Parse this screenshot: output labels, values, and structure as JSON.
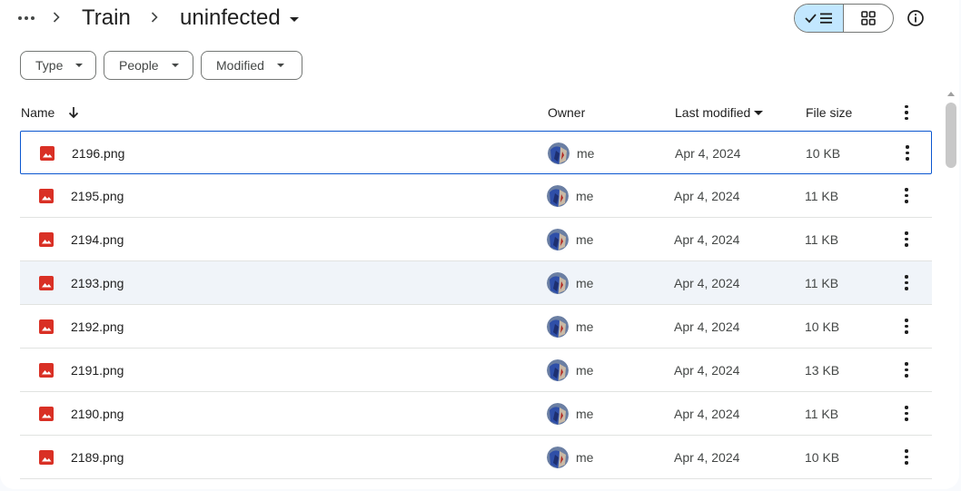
{
  "breadcrumb": {
    "parent": "Train",
    "current": "uninfected"
  },
  "toolbar": {
    "list_view_icon": "check-list-icon",
    "grid_view_icon": "grid-icon",
    "info_icon": "info-icon"
  },
  "filters": [
    {
      "label": "Type"
    },
    {
      "label": "People"
    },
    {
      "label": "Modified"
    }
  ],
  "columns": {
    "name": "Name",
    "owner": "Owner",
    "last_modified": "Last modified",
    "file_size": "File size"
  },
  "files": [
    {
      "name": "2196.png",
      "owner": "me",
      "modified": "Apr 4, 2024",
      "size": "10 KB",
      "state": "selected"
    },
    {
      "name": "2195.png",
      "owner": "me",
      "modified": "Apr 4, 2024",
      "size": "11 KB",
      "state": ""
    },
    {
      "name": "2194.png",
      "owner": "me",
      "modified": "Apr 4, 2024",
      "size": "11 KB",
      "state": ""
    },
    {
      "name": "2193.png",
      "owner": "me",
      "modified": "Apr 4, 2024",
      "size": "11 KB",
      "state": "hover"
    },
    {
      "name": "2192.png",
      "owner": "me",
      "modified": "Apr 4, 2024",
      "size": "10 KB",
      "state": ""
    },
    {
      "name": "2191.png",
      "owner": "me",
      "modified": "Apr 4, 2024",
      "size": "13 KB",
      "state": ""
    },
    {
      "name": "2190.png",
      "owner": "me",
      "modified": "Apr 4, 2024",
      "size": "11 KB",
      "state": ""
    },
    {
      "name": "2189.png",
      "owner": "me",
      "modified": "Apr 4, 2024",
      "size": "10 KB",
      "state": ""
    }
  ],
  "colors": {
    "image_icon": "#d93025",
    "selected_border": "#0b57d0",
    "toggle_active": "#c2e7ff"
  }
}
